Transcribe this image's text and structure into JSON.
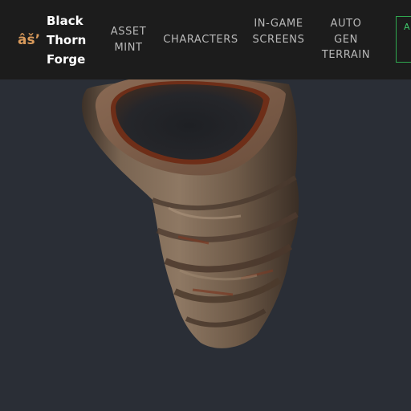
{
  "header": {
    "brand_glyph": "âš’",
    "brand_name": "Black Thorn Forge",
    "nav": {
      "asset_mint": "ASSET MINT",
      "characters": "CHARACTERS",
      "in_game_screens": "IN-GAME SCREENS",
      "auto_gen_terrain": "AUTO GEN TERRAIN",
      "cta": "A S G"
    }
  },
  "colors": {
    "nav_background": "#1c1c1c",
    "brand_glyph": "#d99a5b",
    "nav_link": "#b9b9b9",
    "cta_accent": "#2fa84f",
    "viewport_background": "#2a2e36"
  },
  "viewport": {
    "object": "3d-model-hollow-log"
  }
}
